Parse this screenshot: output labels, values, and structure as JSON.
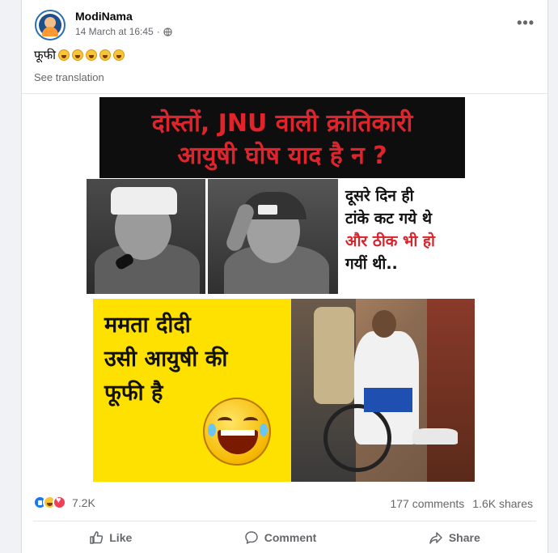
{
  "post": {
    "author": "ModiNama",
    "timestamp": "14 March at 16:45",
    "separator": "·",
    "caption_text": "फूफी",
    "caption_emoji_count": 5,
    "see_translation": "See translation",
    "more_icon": "more-horizontal-icon",
    "privacy_icon": "globe-icon"
  },
  "image_text": {
    "banner_line1": "दोस्तों, JNU वाली क्रांतिकारी",
    "banner_line2": "आयुषी घोष याद है न ?",
    "side_line1": "दूसरे दिन ही",
    "side_line2": "टांके कट गये थे",
    "side_line3": "और ठीक भी हो",
    "side_line4": "गयीं थी..",
    "yellow_line1": "ममता दीदी",
    "yellow_line2": "उसी आयुषी की",
    "yellow_line3": "फूफी है"
  },
  "stats": {
    "reactions_count": "7.2K",
    "comments": "177 comments",
    "shares": "1.6K shares",
    "reaction_icons": [
      "like-icon",
      "haha-icon",
      "love-icon"
    ]
  },
  "actions": {
    "like": "Like",
    "comment": "Comment",
    "share": "Share"
  },
  "colors": {
    "banner_text": "#e0242b",
    "banner_bg": "#0e0e0e",
    "yellow_bg": "#ffe100",
    "like_blue": "#1877f2"
  }
}
